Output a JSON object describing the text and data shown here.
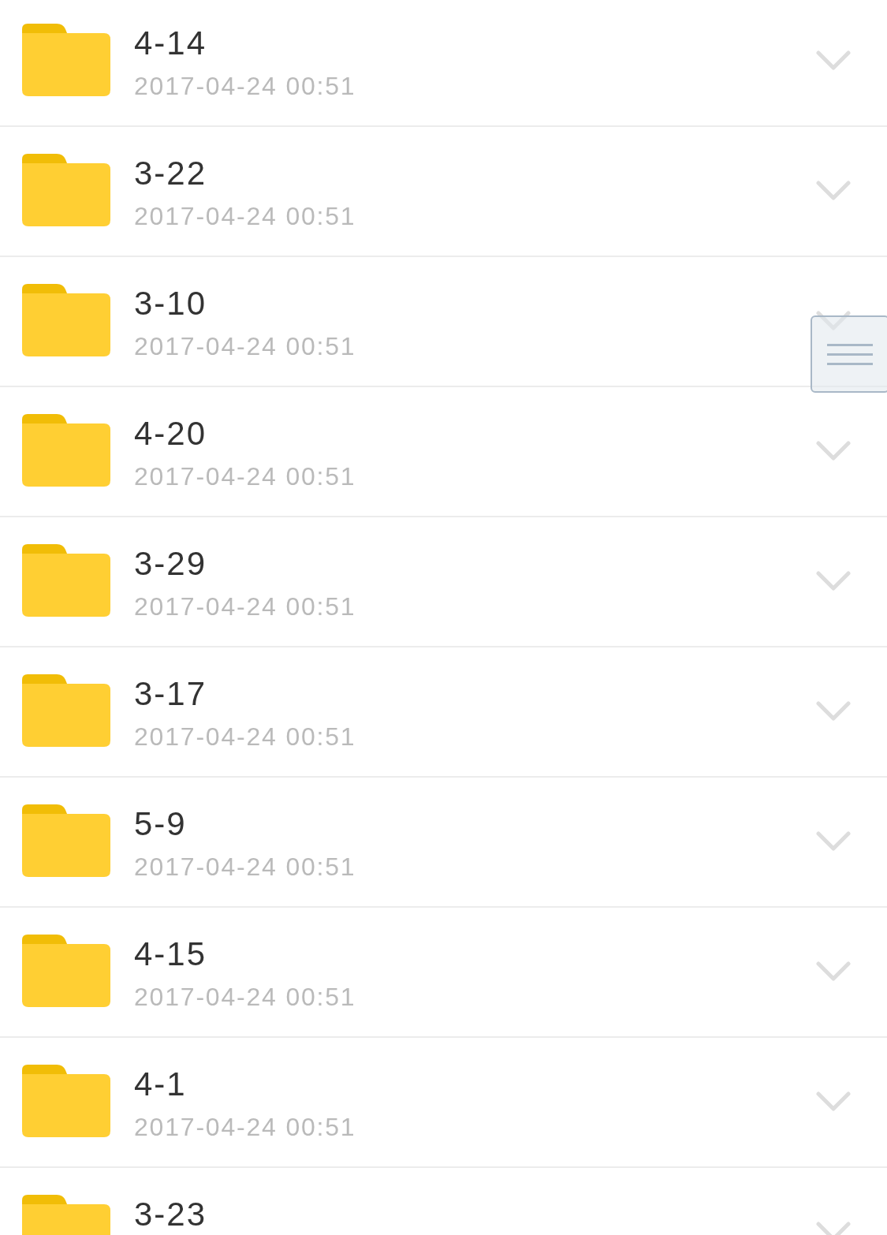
{
  "folders": [
    {
      "name": "4-14",
      "modified": "2017-04-24 00:51"
    },
    {
      "name": "3-22",
      "modified": "2017-04-24 00:51"
    },
    {
      "name": "3-10",
      "modified": "2017-04-24 00:51"
    },
    {
      "name": "4-20",
      "modified": "2017-04-24 00:51"
    },
    {
      "name": "3-29",
      "modified": "2017-04-24 00:51"
    },
    {
      "name": "3-17",
      "modified": "2017-04-24 00:51"
    },
    {
      "name": "5-9",
      "modified": "2017-04-24 00:51"
    },
    {
      "name": "4-15",
      "modified": "2017-04-24 00:51"
    },
    {
      "name": "4-1",
      "modified": "2017-04-24 00:51"
    },
    {
      "name": "3-23"
    }
  ]
}
